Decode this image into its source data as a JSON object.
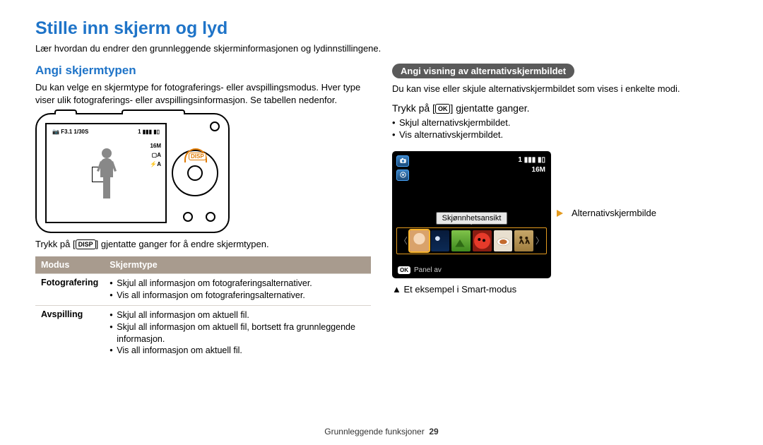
{
  "title": "Stille inn skjerm og lyd",
  "intro": "Lær hvordan du endrer den grunnleggende skjerminformasjonen og lydinnstillingene.",
  "left": {
    "subhead": "Angi skjermtypen",
    "para": "Du kan velge en skjermtype for fotograferings- eller avspillingsmodus. Hver type viser ulik fotograferings- eller avspillingsinformasjon. Se tabellen nedenfor.",
    "instruction_pre": "Trykk på [",
    "instruction_icon": "DISP",
    "instruction_post": "] gjentatte ganger for å endre skjermtypen.",
    "screen": {
      "f_line": "F3.1 1/30S",
      "battery_row": "1 ▮▮▮ ▮▯",
      "res": "16M",
      "af": "▢A",
      "flash": "⚡A"
    },
    "table": {
      "h1": "Modus",
      "h2": "Skjermtype",
      "r1c1": "Fotografering",
      "r1b1": "Skjul all informasjon om fotograferingsalternativer.",
      "r1b2": "Vis all informasjon om fotograferingsalternativer.",
      "r2c1": "Avspilling",
      "r2b1": "Skjul all informasjon om aktuell fil.",
      "r2b2": "Skjul all informasjon om aktuell fil, bortsett fra grunnleggende informasjon.",
      "r2b3": "Vis all informasjon om aktuell fil."
    }
  },
  "right": {
    "pill": "Angi visning av alternativskjermbildet",
    "para": "Du kan vise eller skjule alternativskjermbildet som vises i enkelte modi.",
    "instruction_pre": "Trykk på [",
    "instruction_icon": "OK",
    "instruction_post": "] gjentatte ganger.",
    "b1": "Skjul alternativskjermbildet.",
    "b2": "Vis alternativskjermbildet.",
    "screen": {
      "battery_row": "1 ▮▮▮ ▮▯",
      "res": "16M",
      "tooltip": "Skjønnhetsansikt",
      "panel_off": "Panel av",
      "ok": "OK"
    },
    "callout": "Alternativskjermbilde",
    "example_pre": "▲ ",
    "example": "Et eksempel i Smart-modus"
  },
  "footer": {
    "section": "Grunnleggende funksjoner",
    "page": "29"
  }
}
